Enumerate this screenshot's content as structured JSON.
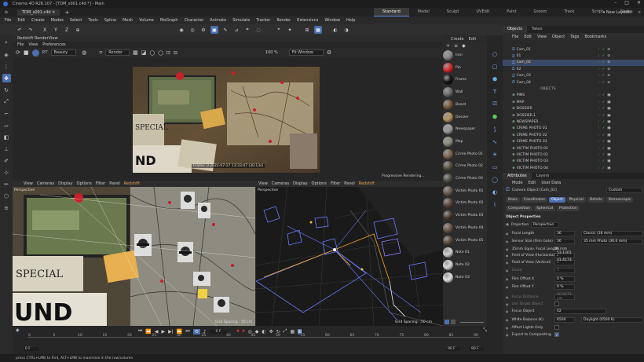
{
  "app": {
    "window_title": "Cinema 4D R26.107 - [TDM_s001.c4d *] - Main",
    "doc_tab": "TDM_s001.c4d",
    "layouts": [
      "Standard",
      "Model",
      "Sculpt",
      "UVEdit",
      "Paint",
      "Groom",
      "Track",
      "Script",
      "Nodes"
    ],
    "active_layout": "Standard",
    "new_layouts": "New Layouts"
  },
  "menubar": [
    "File",
    "Edit",
    "Create",
    "Modes",
    "Select",
    "Tools",
    "Spline",
    "Mesh",
    "Volume",
    "MoGraph",
    "Character",
    "Animate",
    "Simulate",
    "Tracker",
    "Render",
    "Extensions",
    "Window",
    "Help"
  ],
  "toolbar_axes": [
    "X",
    "Y",
    "Z"
  ],
  "renderview": {
    "title": "Redshift RenderView",
    "menu": [
      "File",
      "View",
      "Preferences"
    ],
    "rt_label": "RT",
    "beauty": "Beauty",
    "render_select": "Render",
    "zoom": "100 %",
    "fit": "Fit Window",
    "frame_info": "Frame: 0   2022-07-17  13:33:47  (30.13s)"
  },
  "viewport_left": {
    "menu": [
      "View",
      "Cameras",
      "Display",
      "Options",
      "Filter",
      "Panel",
      "Redshift"
    ],
    "label": "Perspective",
    "grid": "Grid Spacing : 50 cm"
  },
  "viewport_right": {
    "menu": [
      "View",
      "Cameras",
      "Display",
      "Options",
      "Filter",
      "Panel",
      "Redshift"
    ],
    "label": "Perspective",
    "grid": "Grid Spacing : 50 cm",
    "progressive": "Progressive Rendering..."
  },
  "materials": {
    "menu": [
      "Create",
      "Edit"
    ],
    "items": [
      {
        "name": "Iron",
        "color": "#8a8a8a"
      },
      {
        "name": "Pin",
        "color": "#d92a2a"
      },
      {
        "name": "Frame",
        "color": "#151515"
      },
      {
        "name": "Wall",
        "color": "#6d6d6d"
      },
      {
        "name": "Board",
        "color": "#7a5a3c"
      },
      {
        "name": "Dossier",
        "color": "#b49060"
      },
      {
        "name": "Newspaper",
        "color": "#9a9a9a"
      },
      {
        "name": "Map",
        "color": "#8c8c7c"
      },
      {
        "name": "Crime Photo 01",
        "color": "#7a6a50"
      },
      {
        "name": "Crime Photo 02",
        "color": "#5a5040"
      },
      {
        "name": "Crime Photo 03",
        "color": "#4a4a40"
      },
      {
        "name": "Victim Photo 01",
        "color": "#6a5a50"
      },
      {
        "name": "Victim Photo 02",
        "color": "#5a4a40"
      },
      {
        "name": "Victim Photo 03",
        "color": "#4a3a30"
      },
      {
        "name": "Victim Photo 04",
        "color": "#6a5a4a"
      },
      {
        "name": "Victim Photo 05",
        "color": "#5a4a3a"
      },
      {
        "name": "Note 01",
        "color": "#d0d0d0"
      },
      {
        "name": "Note 02",
        "color": "#d8d8d8"
      },
      {
        "name": "Note 03",
        "color": "#e0e0e0"
      }
    ]
  },
  "objects": {
    "tabs": [
      "Objects",
      "Takes"
    ],
    "active_tab": "Objects",
    "menu": [
      "File",
      "Edit",
      "View",
      "Object",
      "Tags",
      "Bookmarks"
    ],
    "rows": [
      {
        "name": "Cam_01",
        "type": "cam",
        "sel": false
      },
      {
        "name": "01",
        "type": "cam",
        "sel": false
      },
      {
        "name": "Cam_02",
        "type": "cam",
        "sel": true
      },
      {
        "name": "02",
        "type": "cam",
        "sel": false
      },
      {
        "name": "Cam_03",
        "type": "cam",
        "sel": false
      },
      {
        "name": "Cam_04",
        "type": "cam",
        "sel": false
      },
      {
        "name": "OBJECTS",
        "type": "sep",
        "sel": false
      },
      {
        "name": "PINS",
        "type": "obj",
        "sel": false
      },
      {
        "name": "MAP",
        "type": "obj",
        "sel": false
      },
      {
        "name": "DOSSIER",
        "type": "obj",
        "sel": false
      },
      {
        "name": "DOSSIER.1",
        "type": "obj",
        "sel": false
      },
      {
        "name": "NEWSPAPER",
        "type": "obj",
        "sel": false
      },
      {
        "name": "CRIME PHOTO 01",
        "type": "obj",
        "sel": false
      },
      {
        "name": "CRIME PHOTO 02",
        "type": "obj",
        "sel": false
      },
      {
        "name": "CRIME PHOTO 03",
        "type": "obj",
        "sel": false
      },
      {
        "name": "VICTIM PHOTO 01",
        "type": "obj",
        "sel": false
      },
      {
        "name": "VICTIM PHOTO 02",
        "type": "obj",
        "sel": false
      },
      {
        "name": "VICTIM PHOTO 03",
        "type": "obj",
        "sel": false
      },
      {
        "name": "VICTIM PHOTO 04",
        "type": "obj",
        "sel": false
      }
    ]
  },
  "attributes": {
    "tabs": [
      "Attributes",
      "Layers"
    ],
    "active_tab": "Attributes",
    "menu": [
      "Mode",
      "Edit",
      "User Data"
    ],
    "object_label": "Camera Object [Cam_02]",
    "custom": "Custom",
    "subtabs1": [
      "Basic",
      "Coordinates",
      "Object",
      "Physical",
      "Details",
      "Stereoscopic"
    ],
    "subtabs2": [
      "Composition",
      "Spherical",
      "Protection"
    ],
    "active_subtab": "Object",
    "section": "Object Properties",
    "projection_label": "Projection",
    "projection_value": "Perspective",
    "fields": [
      {
        "label": "Focal Length",
        "value": "36",
        "extra": "Classic (36 mm)"
      },
      {
        "label": "Sensor Size (Film Gate)",
        "value": "36",
        "extra": "35 mm Photo (36.0 mm)"
      },
      {
        "label": "35mm Equiv. Focal Length:",
        "value": "36 mm",
        "extra": ""
      },
      {
        "label": "Field of View (Horizontal)",
        "value": "53.1301 °",
        "extra": ""
      },
      {
        "label": "Field of View (Vertical)",
        "value": "31.4173 °",
        "extra": ""
      },
      {
        "label": "Zoom",
        "value": "1",
        "extra": ""
      },
      {
        "label": "Film Offset X",
        "value": "0 %",
        "extra": ""
      },
      {
        "label": "Film Offset Y",
        "value": "0 %",
        "extra": ""
      },
      {
        "label": "Focus Distance",
        "value": "40.9271 cm",
        "extra": ""
      },
      {
        "label": "Use Target Object",
        "value": "",
        "extra": ""
      },
      {
        "label": "Focus Object",
        "value": "02",
        "extra": ""
      },
      {
        "label": "White Balance (K)",
        "value": "6500",
        "extra": "Daylight (6500 K)"
      },
      {
        "label": "Affect Lights Only",
        "value": "",
        "extra": ""
      },
      {
        "label": "Export to Compositing",
        "value": "",
        "extra": ""
      }
    ]
  },
  "timeline": {
    "ticks": [
      "0",
      "5",
      "10",
      "15",
      "20",
      "25",
      "30",
      "35",
      "40",
      "45",
      "50",
      "55",
      "60",
      "65",
      "70",
      "75",
      "80",
      "85",
      "90"
    ],
    "frame": "0 F",
    "start": "0 F",
    "start2": "0 F",
    "end": "90 F",
    "end2": "90 F"
  },
  "status": "press CTRL+LMB to find, ALT+LMB to maximize in the row/column",
  "colors": {
    "accent": "#4b6fb0",
    "orange_cam": "#e89a2a",
    "blue_cam": "#6a7cff"
  }
}
